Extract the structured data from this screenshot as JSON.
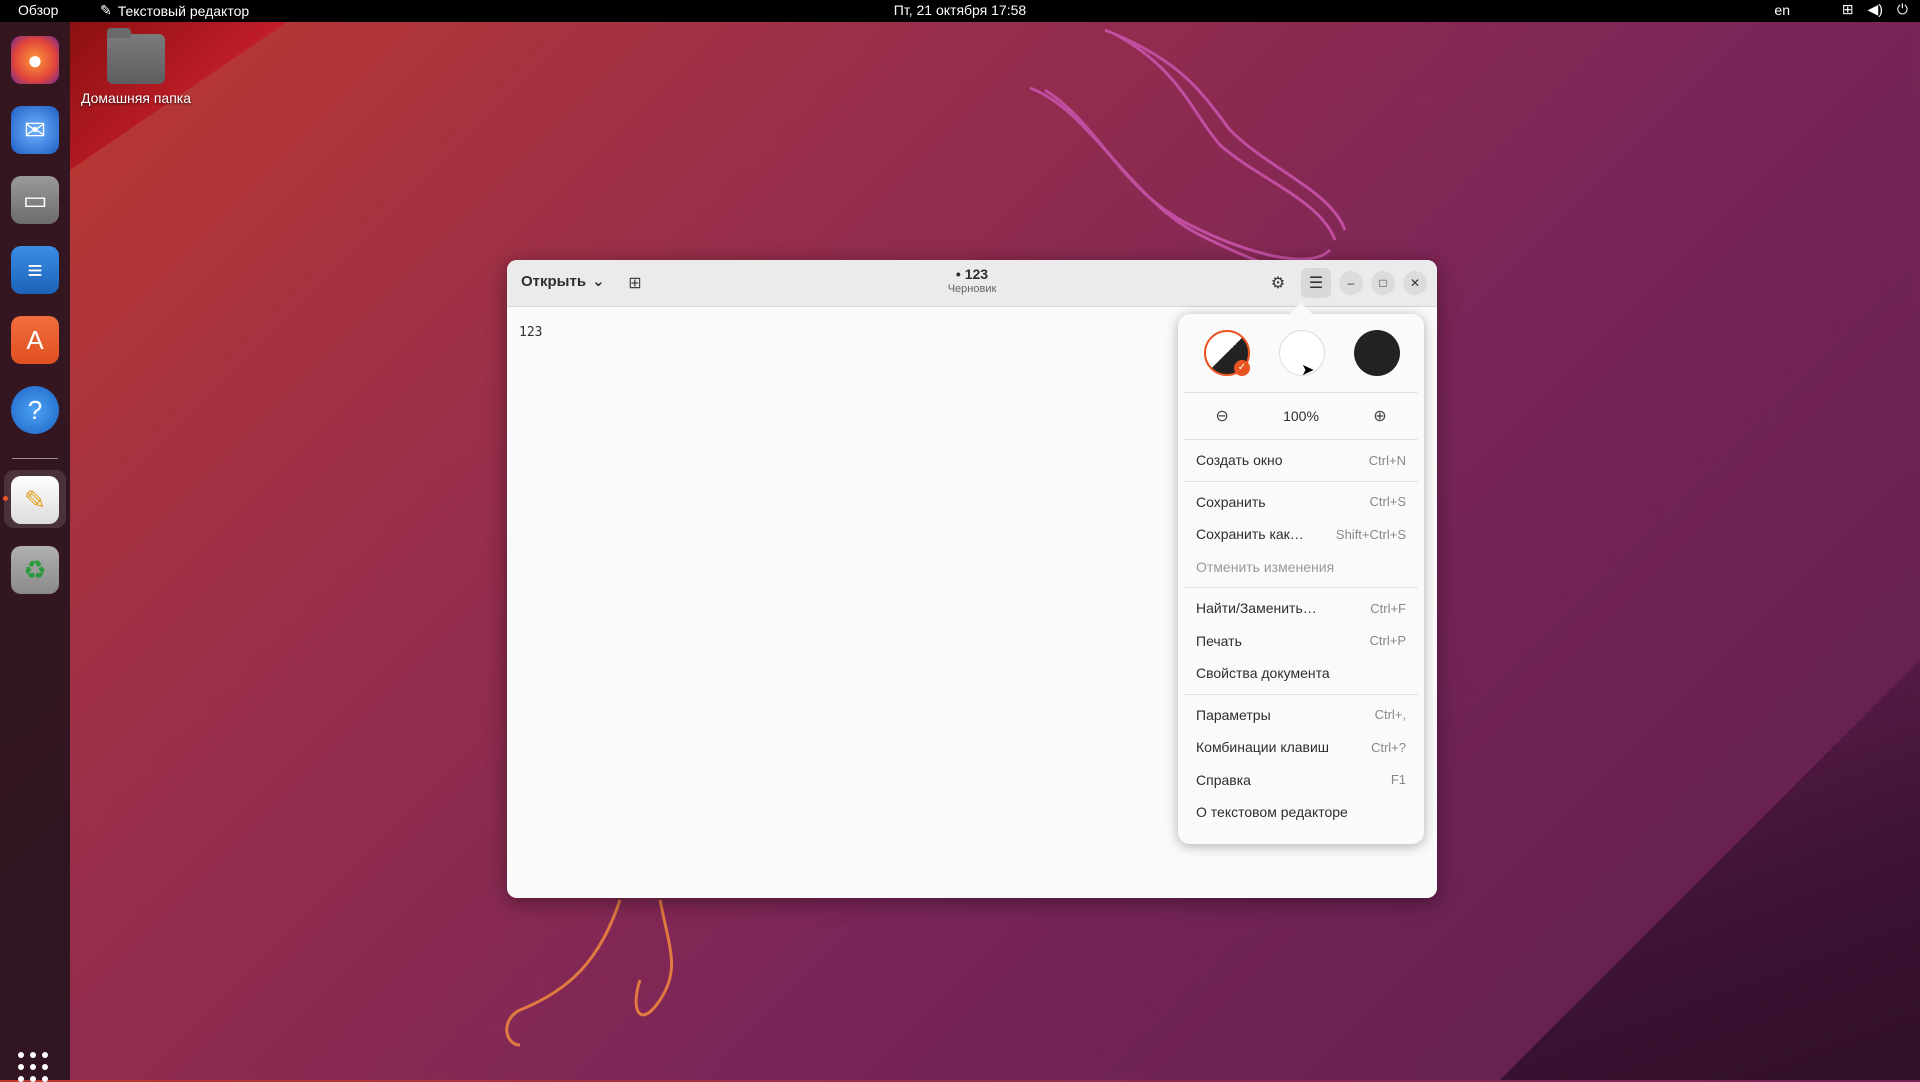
{
  "topbar": {
    "activities": "Обзор",
    "app_name": "Текстовый редактор",
    "clock": "Пт, 21 октября  17:58",
    "lang": "en",
    "tray_icons": [
      "network-icon",
      "volume-icon",
      "power-icon"
    ]
  },
  "dock": {
    "apps": [
      "firefox-icon",
      "thunderbird-icon",
      "files-icon",
      "writer-icon",
      "software-icon",
      "help-icon",
      "text-editor-icon",
      "trash-icon"
    ],
    "show_apps": "apps-grid-icon"
  },
  "desktop": {
    "home_label": "Домашняя папка"
  },
  "window": {
    "open_label": "Открыть",
    "title": "• 123",
    "subtitle": "Черновик",
    "content": "123"
  },
  "menu": {
    "zoom_value": "100%",
    "sections": [
      [
        {
          "label": "Создать окно",
          "accel": "Ctrl+N"
        }
      ],
      [
        {
          "label": "Сохранить",
          "accel": "Ctrl+S"
        },
        {
          "label": "Сохранить как…",
          "accel": "Shift+Ctrl+S"
        },
        {
          "label": "Отменить изменения",
          "accel": ""
        }
      ],
      [
        {
          "label": "Найти/Заменить…",
          "accel": "Ctrl+F"
        },
        {
          "label": "Печать",
          "accel": "Ctrl+P"
        },
        {
          "label": "Свойства документа",
          "accel": ""
        }
      ],
      [
        {
          "label": "Параметры",
          "accel": "Ctrl+,"
        },
        {
          "label": "Комбинации клавиш",
          "accel": "Ctrl+?"
        },
        {
          "label": "Справка",
          "accel": "F1"
        },
        {
          "label": "О текстовом редакторе",
          "accel": ""
        }
      ]
    ]
  },
  "colors": {
    "accent": "#e95420"
  }
}
